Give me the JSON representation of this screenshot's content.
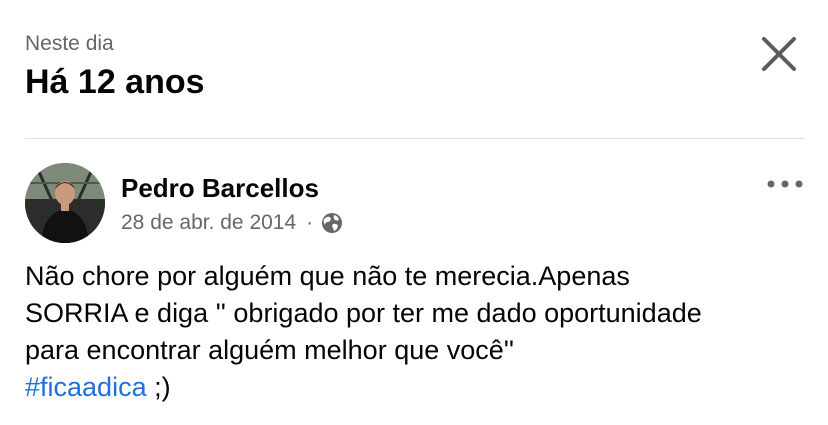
{
  "header": {
    "subtitle": "Neste dia",
    "title": "Há 12 anos"
  },
  "post": {
    "author": "Pedro Barcellos",
    "date": "28 de abr. de 2014",
    "separator": "·",
    "privacy_icon": "globe-icon",
    "more_icon": "ellipsis-icon",
    "text": "Não chore por alguém que não te merecia.Apenas\nSORRIA e diga '' obrigado por ter me dado oportunidade\npara encontrar alguém melhor que você''\n",
    "hashtag": "#ficaadica",
    "text_after_hashtag": " ;)"
  },
  "colors": {
    "primary_text": "#050505",
    "secondary_text": "#65676b",
    "link": "#216fdb",
    "divider": "#dadde1"
  }
}
